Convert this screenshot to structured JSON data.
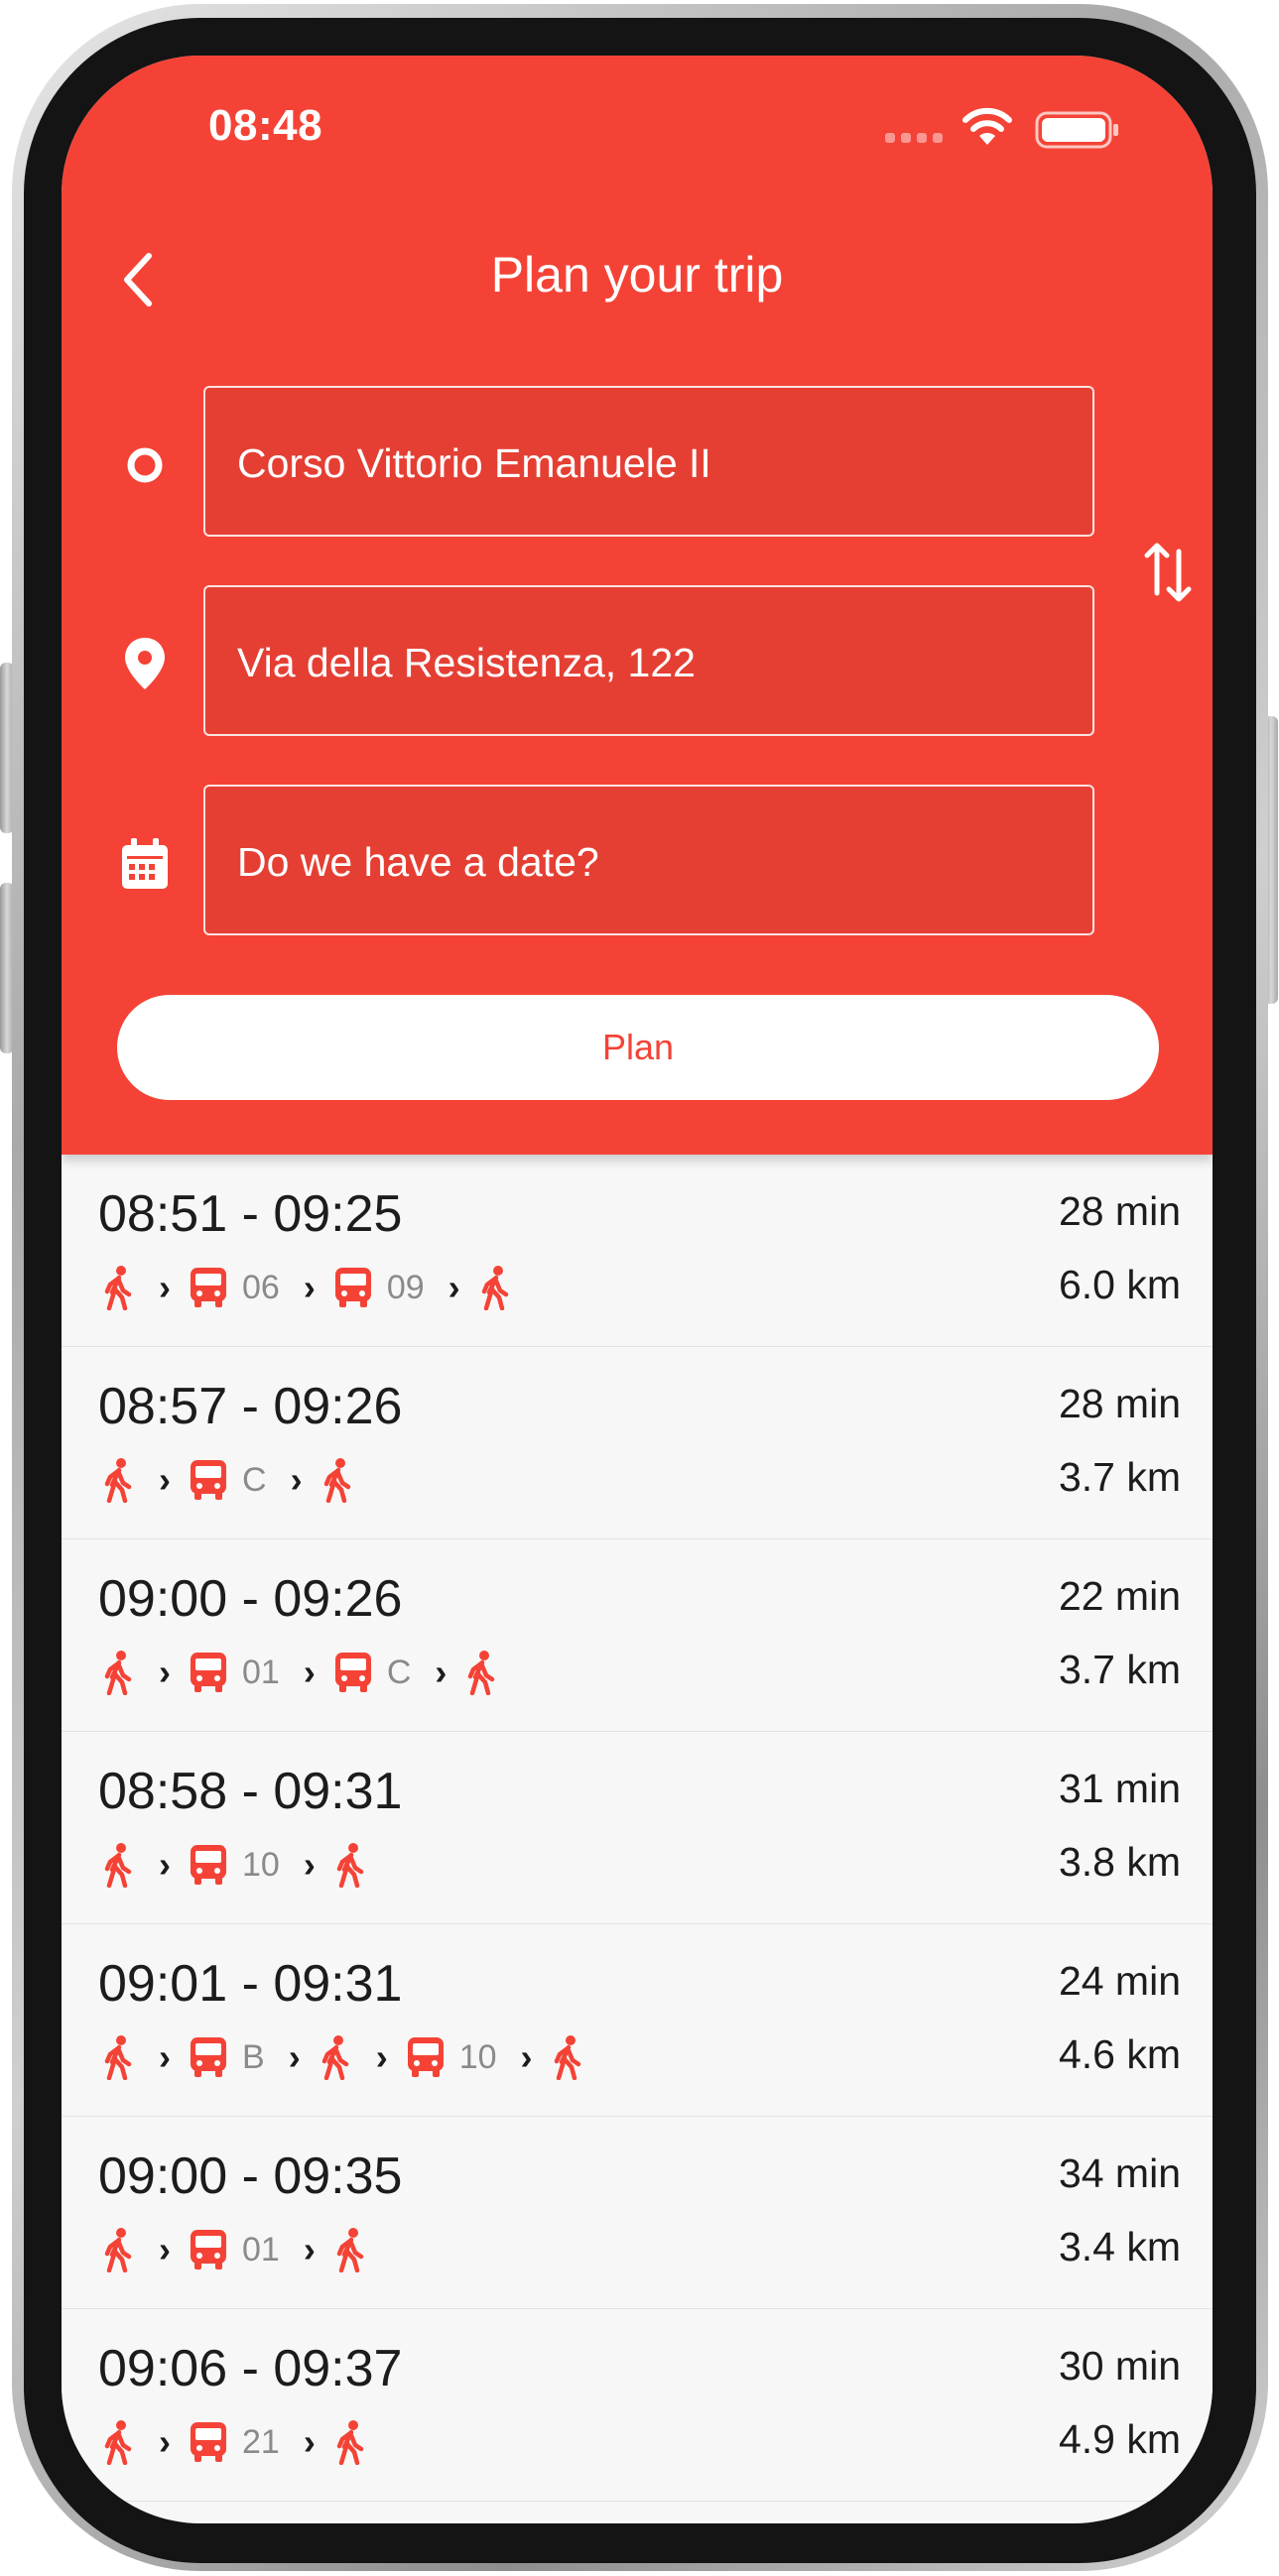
{
  "status_bar": {
    "time": "08:48"
  },
  "header": {
    "title": "Plan your trip"
  },
  "form": {
    "origin": "Corso Vittorio Emanuele II",
    "destination": "Via della Resistenza, 122",
    "date_placeholder": "Do we have a date?",
    "plan_label": "Plan"
  },
  "colors": {
    "primary": "#f44336",
    "list_bg": "#f7f7f7"
  },
  "trips": [
    {
      "time": "08:51 - 09:25",
      "duration": "28 min",
      "distance": "6.0 km",
      "legs": [
        {
          "mode": "walk"
        },
        {
          "mode": "bus",
          "route": "06"
        },
        {
          "mode": "bus",
          "route": "09"
        },
        {
          "mode": "walk"
        }
      ]
    },
    {
      "time": "08:57 - 09:26",
      "duration": "28 min",
      "distance": "3.7 km",
      "legs": [
        {
          "mode": "walk"
        },
        {
          "mode": "bus",
          "route": "C"
        },
        {
          "mode": "walk"
        }
      ]
    },
    {
      "time": "09:00 - 09:26",
      "duration": "22 min",
      "distance": "3.7 km",
      "legs": [
        {
          "mode": "walk"
        },
        {
          "mode": "bus",
          "route": "01"
        },
        {
          "mode": "bus",
          "route": "C"
        },
        {
          "mode": "walk"
        }
      ]
    },
    {
      "time": "08:58 - 09:31",
      "duration": "31 min",
      "distance": "3.8 km",
      "legs": [
        {
          "mode": "walk"
        },
        {
          "mode": "bus",
          "route": "10"
        },
        {
          "mode": "walk"
        }
      ]
    },
    {
      "time": "09:01 - 09:31",
      "duration": "24 min",
      "distance": "4.6 km",
      "legs": [
        {
          "mode": "walk"
        },
        {
          "mode": "bus",
          "route": "B"
        },
        {
          "mode": "walk"
        },
        {
          "mode": "bus",
          "route": "10"
        },
        {
          "mode": "walk"
        }
      ]
    },
    {
      "time": "09:00 - 09:35",
      "duration": "34 min",
      "distance": "3.4 km",
      "legs": [
        {
          "mode": "walk"
        },
        {
          "mode": "bus",
          "route": "01"
        },
        {
          "mode": "walk"
        }
      ]
    },
    {
      "time": "09:06 - 09:37",
      "duration": "30 min",
      "distance": "4.9 km",
      "legs": [
        {
          "mode": "walk"
        },
        {
          "mode": "bus",
          "route": "21"
        },
        {
          "mode": "walk"
        }
      ]
    }
  ]
}
